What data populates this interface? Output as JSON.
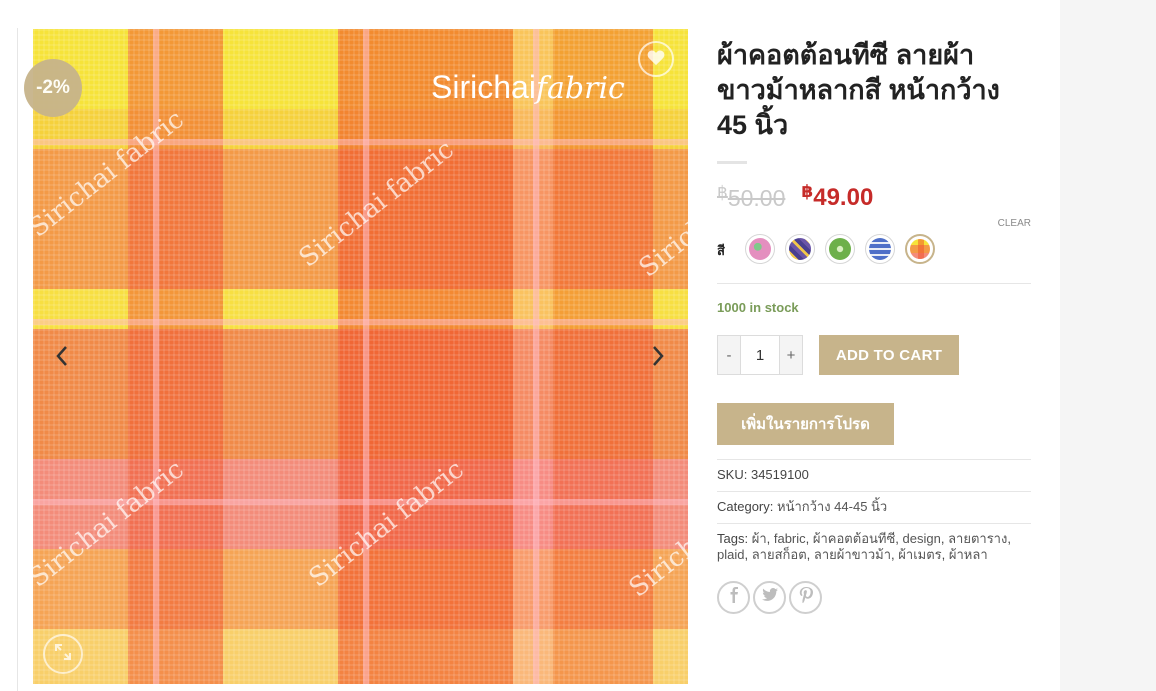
{
  "product": {
    "title": "ผ้าคอตต้อนทีซี ลายผ้าขาวม้าหลากสี หน้ากว้าง 45 นิ้ว",
    "sale_badge": "-2%",
    "brand_watermark": "Sirichai fabric",
    "price_currency": "฿",
    "price_regular": "50.00",
    "price_sale": "49.00"
  },
  "variation": {
    "label": "สี",
    "clear_label": "CLEAR",
    "swatches": [
      {
        "name": "pink-floral",
        "color": "#e48fbf",
        "selected": false
      },
      {
        "name": "purple-pattern",
        "color": "#6b55a8",
        "selected": false
      },
      {
        "name": "green-leaf",
        "color": "#6db04a",
        "selected": false
      },
      {
        "name": "blue-pattern",
        "color": "#4f6fc8",
        "selected": false
      },
      {
        "name": "orange-plaid",
        "color": "#f0a04a",
        "selected": true
      }
    ]
  },
  "stock": "1000 in stock",
  "cart": {
    "minus": "-",
    "plus": "+",
    "quantity": "1",
    "add_to_cart": "ADD TO CART",
    "add_to_wishlist": "เพิ่มในรายการโปรด"
  },
  "meta": {
    "sku_label": "SKU:",
    "sku": "34519100",
    "category_label": "Category:",
    "category": "หน้ากว้าง 44-45 นิ้ว",
    "tags_label": "Tags:",
    "tags": [
      "ผ้า",
      "fabric",
      "ผ้าคอตต้อนทีซี",
      "design",
      "ลายตาราง",
      "plaid",
      "ลายสก็อต",
      "ลายผ้าขาวม้า",
      "ผ้าเมตร",
      "ผ้าหลา"
    ]
  },
  "icons": {
    "wishlist": "heart-icon",
    "prev": "chevron-left-icon",
    "next": "chevron-right-icon",
    "zoom": "zoom-icon",
    "share": [
      "facebook-icon",
      "twitter-icon",
      "pinterest-icon"
    ]
  },
  "colors": {
    "accent": "#c7b48b",
    "sale_price": "#c62b29",
    "stock": "#7a9c59"
  }
}
